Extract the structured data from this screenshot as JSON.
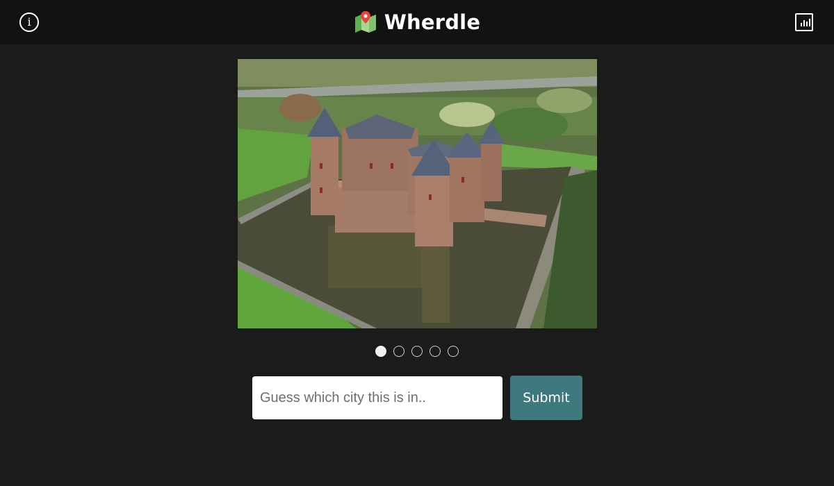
{
  "header": {
    "title": "Wherdle",
    "info_icon": "info-icon",
    "stats_icon": "stats-chart-icon",
    "logo_icon": "map-pin-logo-icon"
  },
  "clue": {
    "image_description_icon": "castle-photo",
    "attempts_total": 5,
    "attempt_current": 1
  },
  "guess": {
    "placeholder": "Guess which city this is in..",
    "value": "",
    "submit_label": "Submit"
  },
  "colors": {
    "background": "#1b1b1b",
    "header": "#121212",
    "submit": "#3e7a7d"
  }
}
